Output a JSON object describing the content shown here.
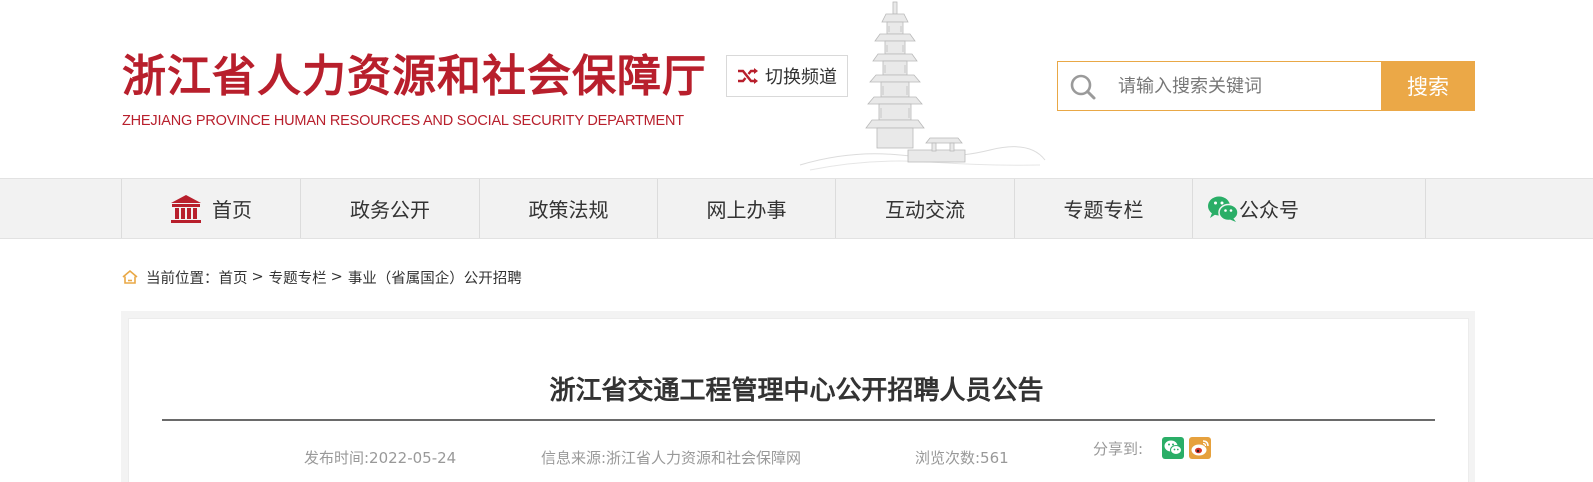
{
  "header": {
    "site_title_cn": "浙江省人力资源和社会保障厅",
    "site_title_en": "ZHEJIANG PROVINCE HUMAN RESOURCES AND SOCIAL SECURITY DEPARTMENT",
    "switch_channel_label": "切换频道",
    "search_placeholder": "请输入搜索关键词",
    "search_button_label": "搜索"
  },
  "nav": {
    "items": [
      {
        "label": "首页"
      },
      {
        "label": "政务公开"
      },
      {
        "label": "政策法规"
      },
      {
        "label": "网上办事"
      },
      {
        "label": "互动交流"
      },
      {
        "label": "专题专栏"
      },
      {
        "label": "公众号"
      }
    ]
  },
  "breadcrumb": {
    "prefix": "当前位置：",
    "items": [
      "首页",
      "专题专栏",
      "事业（省属国企）公开招聘"
    ],
    "separator": ">"
  },
  "article": {
    "title": "浙江省交通工程管理中心公开招聘人员公告",
    "publish_time": "发布时间:2022-05-24",
    "source": "信息来源:浙江省人力资源和社会保障网",
    "views": "浏览次数:561",
    "share_label": "分享到:"
  },
  "colors": {
    "brand_red": "#b81f2c",
    "accent_orange": "#eba847",
    "nav_bg": "#f2f2f2",
    "wechat_green": "#2aae67",
    "weibo_orange": "#e6a13d"
  },
  "icons": [
    "shuffle-icon",
    "search-icon",
    "home-building-icon",
    "wechat-icon",
    "breadcrumb-home-icon",
    "share-wechat-icon",
    "share-weibo-icon"
  ]
}
